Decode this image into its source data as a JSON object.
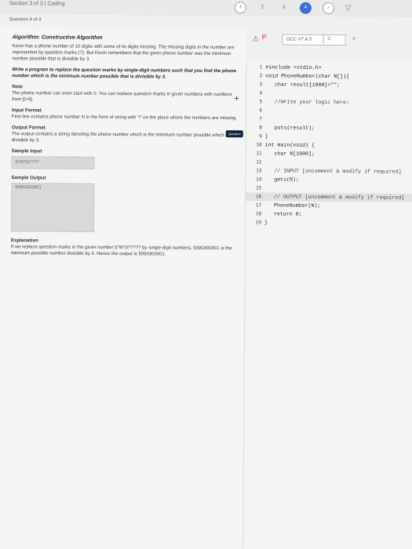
{
  "topbar": {
    "section": "Section 3 of 3 | Coding",
    "steps": [
      "1",
      "2",
      "3",
      "4"
    ]
  },
  "question": {
    "label": "Question 4 of 4"
  },
  "problem": {
    "title": "Algorithm: Constructive Algorithm",
    "intro": "Kevin has a phone number of 10 digits with some of its digits missing. The missing digits in the number are represented by question marks (?). But Kevin remembers that the given phone number was the minimum number possible that is divisible by 3.",
    "task": "Write a program to replace the question marks by single-digit numbers such that you find the phone number which is the minimum number possible that is divisible by 3.",
    "note_head": "Note",
    "note": "The phone number can even start with 0. You can replace question marks in given numbers with numbers from [0-9].",
    "input_head": "Input Format",
    "input": "First line contains phone number N in the form of string with '?' on the place where the numbers are missing.",
    "output_head": "Output Format",
    "output": "The output contains a string denoting the phone number which is the minimum number possible which is divisible by 3.",
    "sample_input_head": "Sample Input",
    "sample_input": "5?9?3????",
    "sample_output_head": "Sample Output",
    "sample_output": "5090300001",
    "explanation_head": "Explanation",
    "explanation": "If we replace question marks in the given number 5?9?3????? by single-digit numbers, 5090300001 is the minimum possible number divisible by 3. Hence the output is 5090300001."
  },
  "toolbar": {
    "language": "GCC V7.4.0",
    "lang_tag": "C"
  },
  "editor": {
    "side_label": "Question",
    "lines": [
      "#include <stdio.h>",
      "void PhoneNumber(char N[]){",
      "   char result[1000]=\"\";",
      "",
      "   //Write your logic here:",
      "",
      "",
      "   puts(result);",
      "}",
      "int main(void) {",
      "   char N[1000];",
      "",
      "   // INPUT [uncomment & modify if required]",
      "   gets(N);",
      "",
      "   // OUTPUT [uncomment & modify if required]",
      "   PhoneNumber(N);",
      "   return 0;",
      "}"
    ],
    "line_numbers": [
      "1",
      "2",
      "3",
      "4",
      "5",
      "6",
      "7",
      "8",
      "9",
      "10",
      "11",
      "12",
      "13",
      "14",
      "15",
      "16",
      "17",
      "18",
      "19"
    ]
  },
  "colors": {
    "accent": "#3d6fd8",
    "warning": "#dd2233"
  },
  "icons": [
    "warning-icon",
    "parking-icon",
    "chevron-down-icon",
    "funnel-icon",
    "plus-icon"
  ]
}
